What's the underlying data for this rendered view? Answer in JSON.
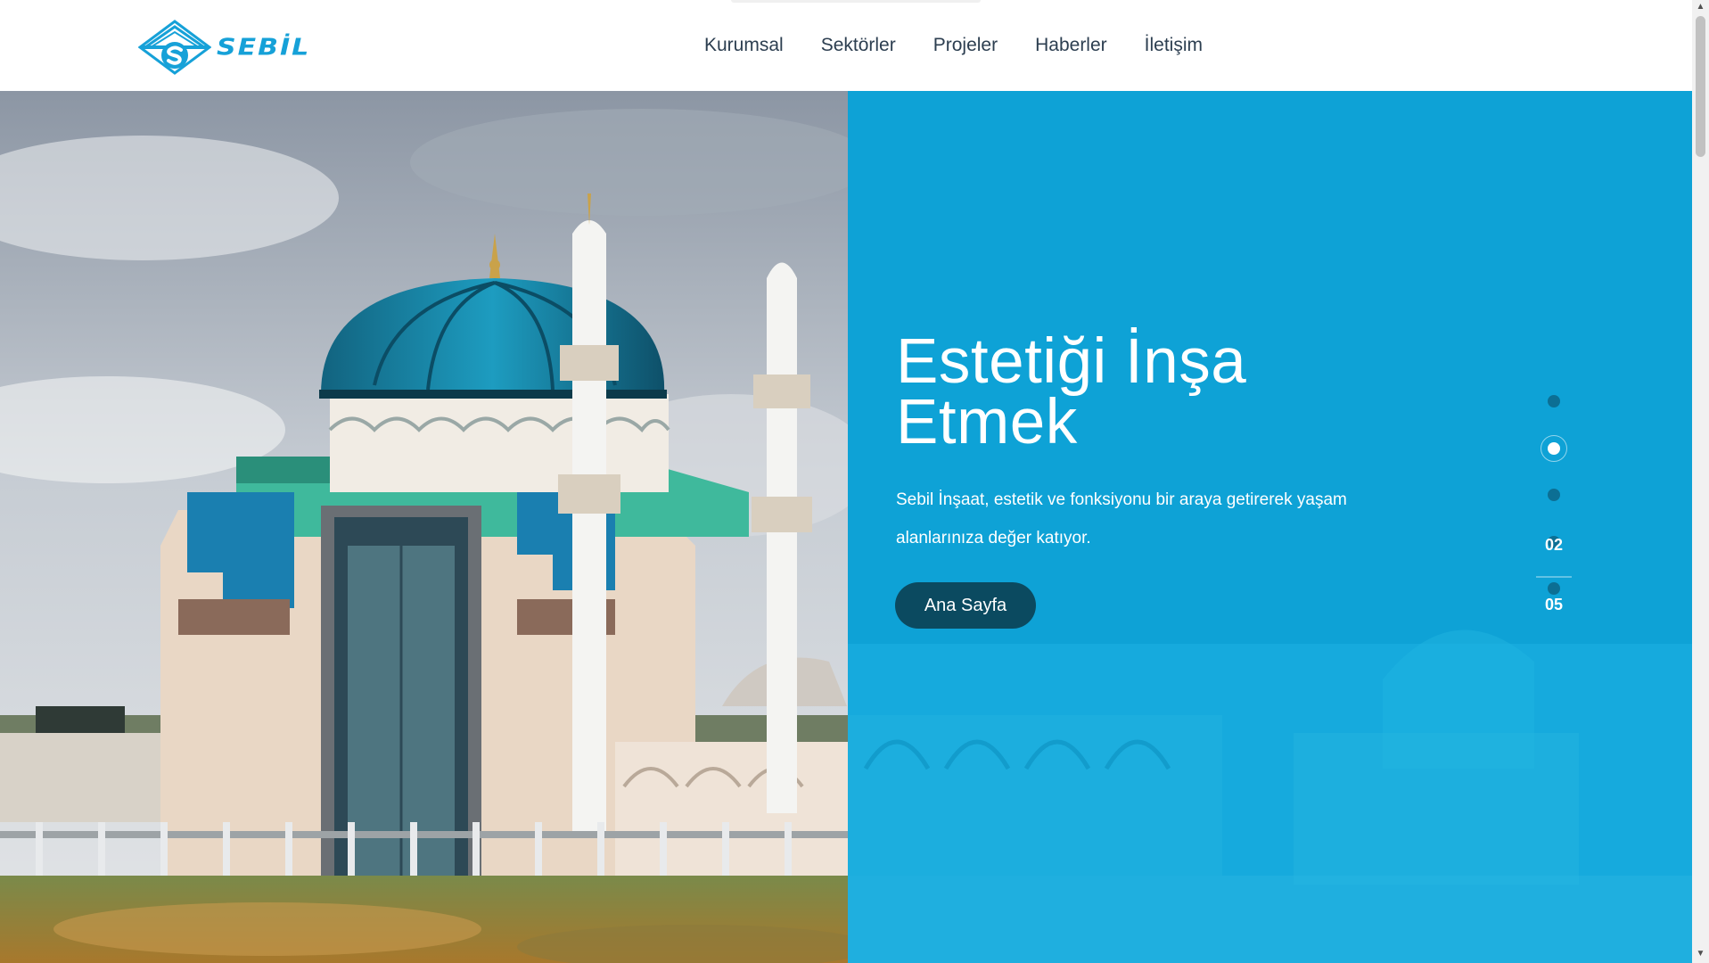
{
  "brand": {
    "logo_text": "SEBİL",
    "primary_color": "#16a1d8",
    "dark_color": "#0b4a60"
  },
  "nav": {
    "items": [
      "Kurumsal",
      "Sektörler",
      "Projeler",
      "Haberler",
      "İletişim"
    ]
  },
  "hero": {
    "title": "Estetiği İnşa Etmek",
    "description": "Sebil İnşaat, estetik ve fonksiyonu bir araya getirerek yaşam alanlarınıza değer katıyor.",
    "button_label": "Ana Sayfa",
    "slide_current": "02",
    "slide_total": "05",
    "slide_count": 5,
    "active_slide_index": 1,
    "panel_color": "#0ea2d6",
    "image_subject": "mosque-icon"
  }
}
